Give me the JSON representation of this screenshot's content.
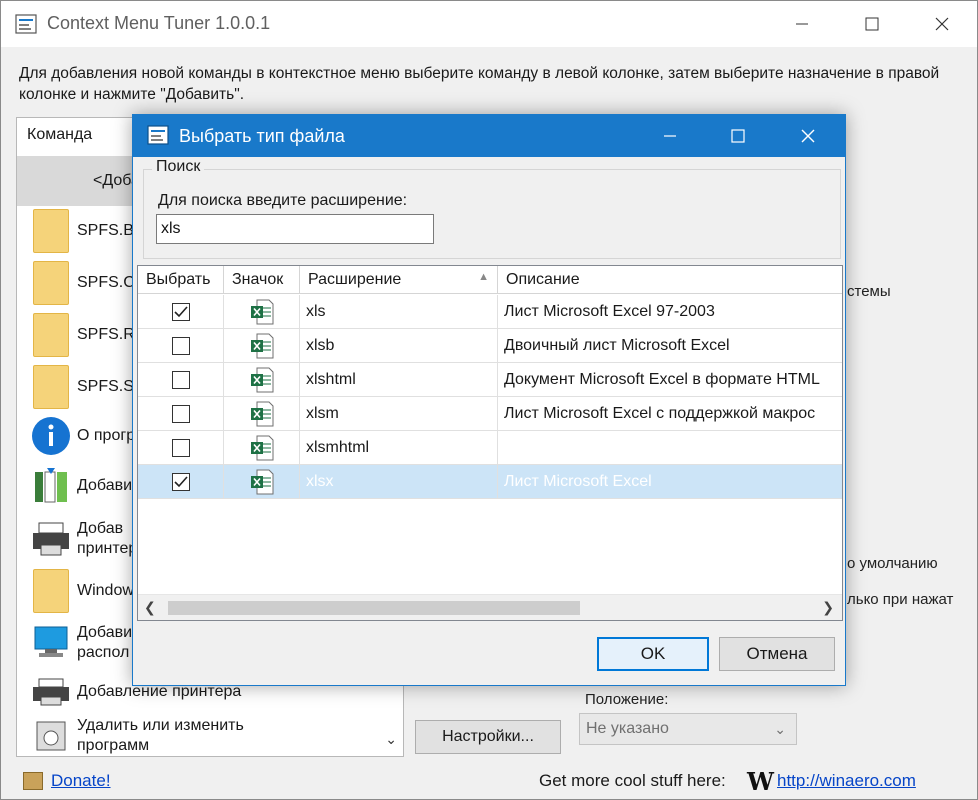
{
  "main_window": {
    "title": "Context Menu Tuner 1.0.0.1",
    "description": "Для добавления новой команды в контекстное меню выберите команду в левой колонке, затем выберите назначение в правой колонке и нажмите \"Добавить\".",
    "command_header": "Команда",
    "commands": [
      {
        "label": "<Добав",
        "icon": "none",
        "selected": true
      },
      {
        "label": "SPFS.B",
        "icon": "folder-icon"
      },
      {
        "label": "SPFS.C",
        "icon": "folder-icon"
      },
      {
        "label": "SPFS.R",
        "icon": "folder-icon"
      },
      {
        "label": "SPFS.S",
        "icon": "folder-icon"
      },
      {
        "label": "О прогр",
        "icon": "info-icon"
      },
      {
        "label": "Добави",
        "icon": "library-icon"
      },
      {
        "label": "Добав",
        "label2": "принтер",
        "icon": "printer-icon"
      },
      {
        "label": "Window",
        "icon": "folder-icon"
      },
      {
        "label": "Добави",
        "label2": "распол",
        "icon": "network-icon"
      },
      {
        "label": "Добавление принтера",
        "icon": "printer-icon"
      },
      {
        "label": "Удалить или изменить",
        "label2": "программ",
        "icon": "uninstall-icon"
      }
    ],
    "right_panel": {
      "label_systems": "стемы",
      "label_default": "о умолчанию",
      "label_click": "лько при нажат",
      "position_label": "Положение:",
      "position_value": "Не указано",
      "settings_button": "Настройки..."
    },
    "footer": {
      "donate": "Donate!",
      "more": "Get more cool stuff here:",
      "logo": "W",
      "site": "http://winaero.com"
    }
  },
  "dialog": {
    "title": "Выбрать тип файла",
    "search_group": "Поиск",
    "search_label": "Для поиска введите расширение:",
    "search_value": "xls",
    "columns": [
      "Выбрать",
      "Значок",
      "Расширение",
      "Описание"
    ],
    "rows": [
      {
        "checked": true,
        "ext": "xls",
        "desc": "Лист Microsoft Excel 97-2003",
        "highlighted": false
      },
      {
        "checked": false,
        "ext": "xlsb",
        "desc": "Двоичный лист Microsoft Excel",
        "highlighted": false
      },
      {
        "checked": false,
        "ext": "xlshtml",
        "desc": "Документ Microsoft Excel в формате HTML",
        "highlighted": false
      },
      {
        "checked": false,
        "ext": "xlsm",
        "desc": "Лист Microsoft Excel с поддержкой макрос",
        "highlighted": false
      },
      {
        "checked": false,
        "ext": "xlsmhtml",
        "desc": "",
        "highlighted": false
      },
      {
        "checked": true,
        "ext": "xlsx",
        "desc": "Лист Microsoft Excel",
        "highlighted": true
      }
    ],
    "ok": "OK",
    "cancel": "Отмена"
  },
  "colors": {
    "dialog_titlebar": "#1979ca",
    "row_highlight": "#cce4f7",
    "link": "#0645c8",
    "excel_green": "#1e7145"
  }
}
